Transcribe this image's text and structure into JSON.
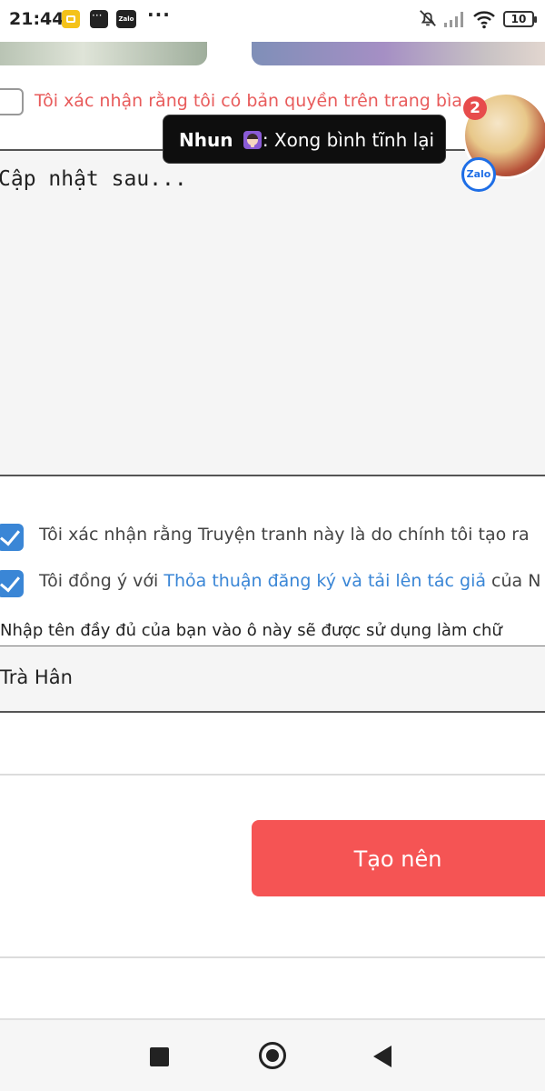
{
  "status_bar": {
    "time": "21:44",
    "zalo_label": "Zalo",
    "more": "···",
    "battery": "10",
    "icons": [
      "notification-app-icon",
      "message-icon",
      "zalo-icon",
      "bell-off-icon",
      "signal-icon",
      "wifi-icon",
      "battery-icon"
    ]
  },
  "copyright_cover": {
    "label": "Tôi xác nhận rằng tôi có bản quyền trên trang bìa",
    "checked": false
  },
  "chat_toast": {
    "sender": "Nhun",
    "message": ": Xong bình tĩnh lại"
  },
  "chat_head": {
    "badge_count": "2",
    "app_label": "Zalo"
  },
  "description": {
    "value": "Cập nhật sau..."
  },
  "agreements": {
    "creator_label": "Tôi xác nhận rằng Truyện tranh này là do chính tôi tạo ra",
    "creator_checked": true,
    "terms_prefix": "Tôi đồng ý với ",
    "terms_link": "Thỏa thuận đăng ký và tải lên tác giả",
    "terms_suffix": " của N",
    "terms_checked": true
  },
  "signature": {
    "label": "Nhập tên đầy đủ của bạn vào ô này sẽ được sử dụng làm chữ",
    "value": "Trà Hân"
  },
  "actions": {
    "create_label": "Tạo nên"
  },
  "colors": {
    "accent_red": "#f55454",
    "warning_text": "#e85b5b",
    "link_blue": "#3a86d6",
    "checkbox_blue": "#3a86d6"
  }
}
